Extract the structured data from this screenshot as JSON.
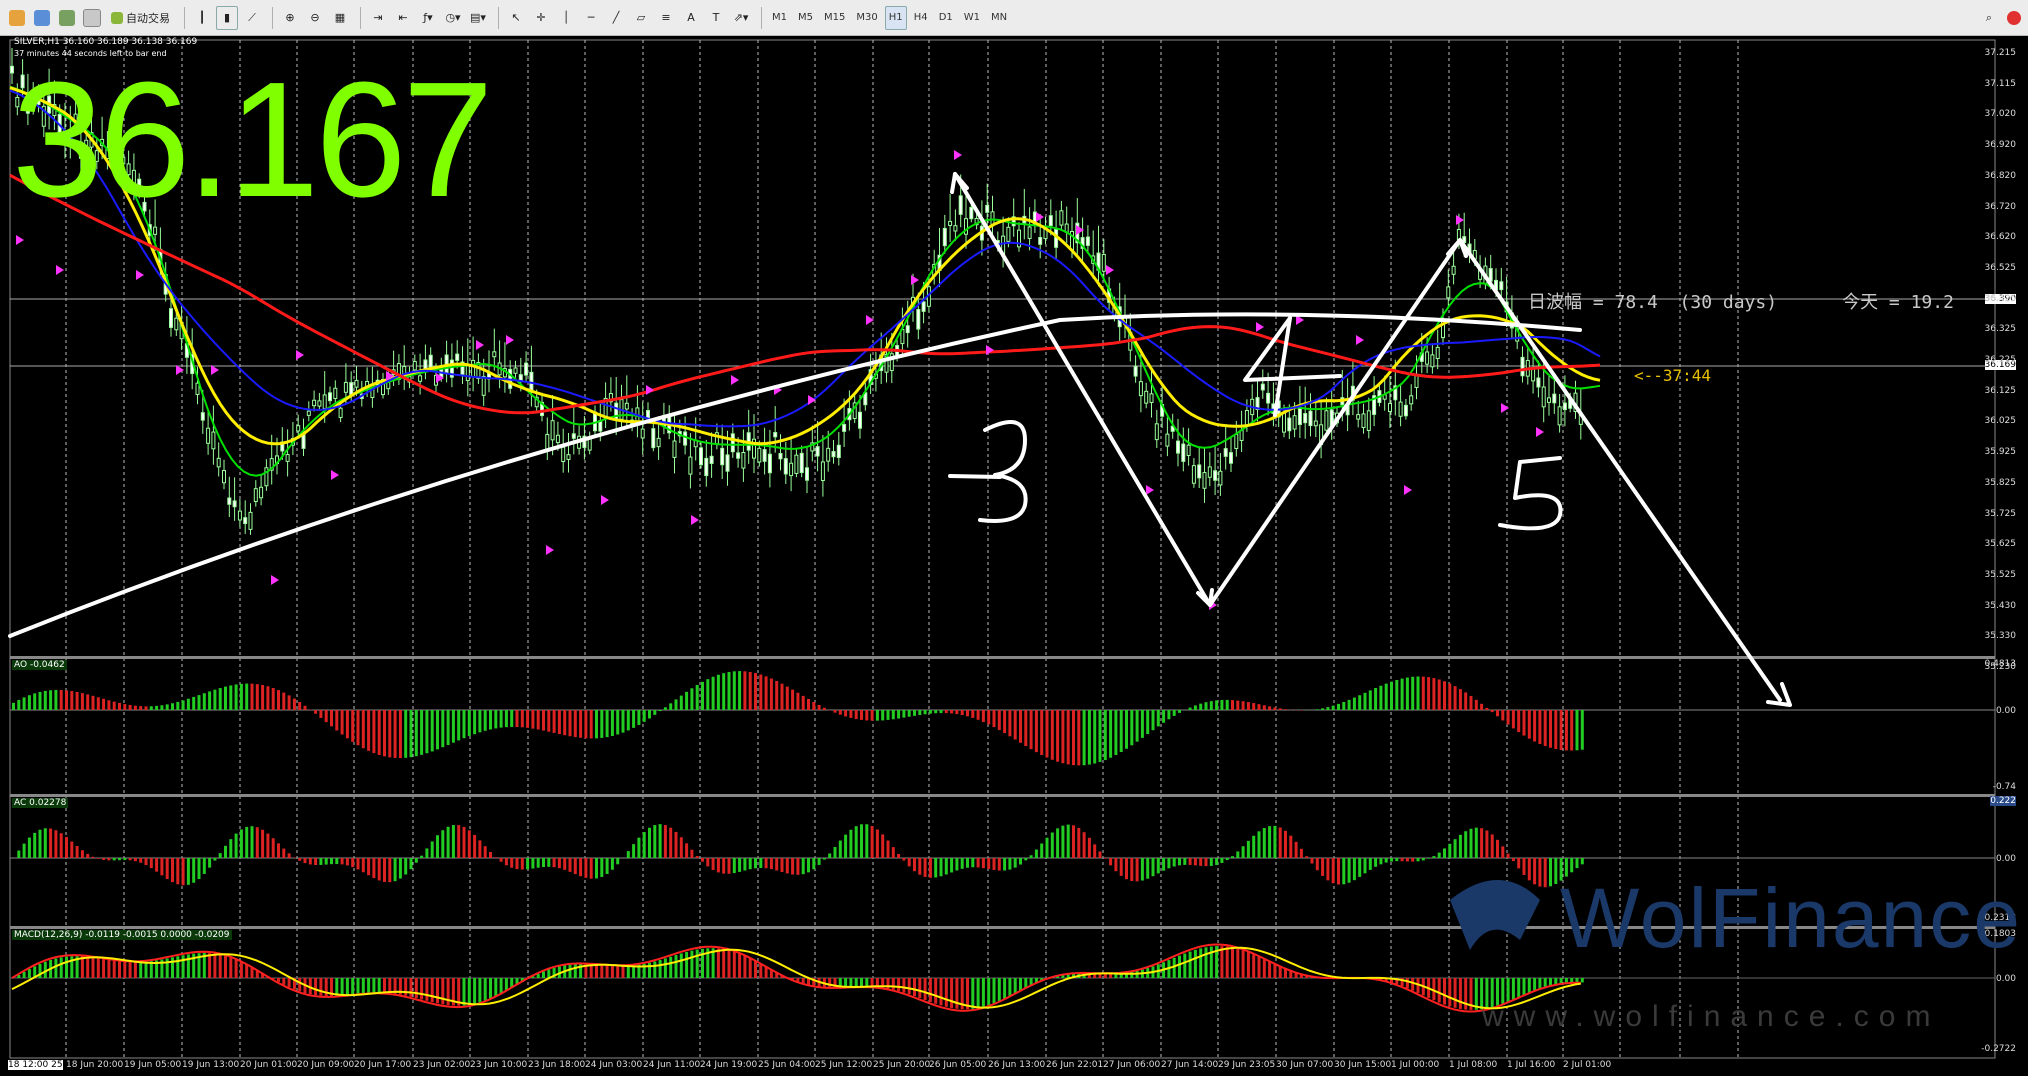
{
  "toolbar": {
    "autotrade_label": "自动交易",
    "periods": [
      "M1",
      "M5",
      "M15",
      "M30",
      "H1",
      "H4",
      "D1",
      "W1",
      "MN"
    ],
    "active_period": "H1"
  },
  "chart": {
    "symbol_info": "SILVER,H1  36.160 36.189 36.138 36.169",
    "bar_timer": "37 minutes 44 seconds left to bar end",
    "big_price": "36.167",
    "range_info": "日波幅 = 78.4  (30 days)      今天 = 19.2",
    "time_left_marker": "<--37:44",
    "current_price_tag": "36.169",
    "ref_price_tag": "36.390",
    "price_axis": [
      "37.215",
      "37.115",
      "37.020",
      "36.920",
      "36.820",
      "36.720",
      "36.620",
      "36.525",
      "36.425",
      "36.325",
      "36.225",
      "36.125",
      "36.025",
      "35.925",
      "35.825",
      "35.725",
      "35.625",
      "35.525",
      "35.430",
      "35.330",
      "35.230"
    ],
    "time_axis": [
      "18 12:00 25",
      "18 Jun 20:00",
      "19 Jun 05:00",
      "19 Jun 13:00",
      "20 Jun 01:00",
      "20 Jun 09:00",
      "20 Jun 17:00",
      "23 Jun 02:00",
      "23 Jun 10:00",
      "23 Jun 18:00",
      "24 Jun 03:00",
      "24 Jun 11:00",
      "24 Jun 19:00",
      "25 Jun 04:00",
      "25 Jun 12:00",
      "25 Jun 20:00",
      "26 Jun 05:00",
      "26 Jun 13:00",
      "26 Jun 22:01",
      "27 Jun 06:00",
      "27 Jun 14:00",
      "29 Jun 23:05",
      "30 Jun 07:00",
      "30 Jun 15:00",
      "1 Jul 00:00",
      "1 Jul 08:00",
      "1 Jul 16:00",
      "2 Jul 01:00"
    ],
    "wave_labels": [
      "3",
      "4",
      "5"
    ]
  },
  "indicators": {
    "ao": {
      "label": "AO -0.0462",
      "max": "0.4813",
      "zero": "0.00",
      "min": "-0.74"
    },
    "ac": {
      "label": "AC 0.02278",
      "max": "0.222",
      "zero": "0.00",
      "min": "-0.2318"
    },
    "macd": {
      "label": "MACD(12,26,9) -0.0119 -0.0015 0.0000 -0.0209",
      "max": "0.1803",
      "zero": "0.00",
      "min": "-0.2722"
    }
  },
  "watermark": {
    "brand": "WolFinance",
    "url": "www.wolfinance.com"
  },
  "colors": {
    "bull": "#22cc22",
    "bear": "#dd2222",
    "candle": "#9aff9a",
    "ma_red": "#ff1a1a",
    "ma_blue": "#1a1aff",
    "ma_yellow": "#ffee00",
    "ma_green": "#00e000",
    "arrow": "#ff33ff",
    "big_price": "#7fff00"
  }
}
